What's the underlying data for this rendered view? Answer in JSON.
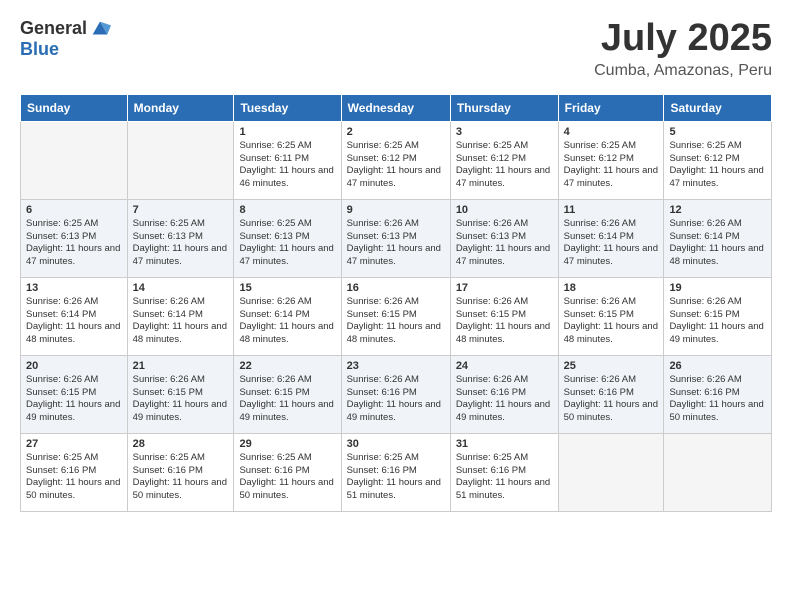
{
  "header": {
    "logo_general": "General",
    "logo_blue": "Blue",
    "month": "July 2025",
    "location": "Cumba, Amazonas, Peru"
  },
  "days_of_week": [
    "Sunday",
    "Monday",
    "Tuesday",
    "Wednesday",
    "Thursday",
    "Friday",
    "Saturday"
  ],
  "weeks": [
    [
      {
        "day": "",
        "sunrise": "",
        "sunset": "",
        "daylight": "",
        "empty": true
      },
      {
        "day": "",
        "sunrise": "",
        "sunset": "",
        "daylight": "",
        "empty": true
      },
      {
        "day": "1",
        "sunrise": "Sunrise: 6:25 AM",
        "sunset": "Sunset: 6:11 PM",
        "daylight": "Daylight: 11 hours and 46 minutes."
      },
      {
        "day": "2",
        "sunrise": "Sunrise: 6:25 AM",
        "sunset": "Sunset: 6:12 PM",
        "daylight": "Daylight: 11 hours and 47 minutes."
      },
      {
        "day": "3",
        "sunrise": "Sunrise: 6:25 AM",
        "sunset": "Sunset: 6:12 PM",
        "daylight": "Daylight: 11 hours and 47 minutes."
      },
      {
        "day": "4",
        "sunrise": "Sunrise: 6:25 AM",
        "sunset": "Sunset: 6:12 PM",
        "daylight": "Daylight: 11 hours and 47 minutes."
      },
      {
        "day": "5",
        "sunrise": "Sunrise: 6:25 AM",
        "sunset": "Sunset: 6:12 PM",
        "daylight": "Daylight: 11 hours and 47 minutes."
      }
    ],
    [
      {
        "day": "6",
        "sunrise": "Sunrise: 6:25 AM",
        "sunset": "Sunset: 6:13 PM",
        "daylight": "Daylight: 11 hours and 47 minutes."
      },
      {
        "day": "7",
        "sunrise": "Sunrise: 6:25 AM",
        "sunset": "Sunset: 6:13 PM",
        "daylight": "Daylight: 11 hours and 47 minutes."
      },
      {
        "day": "8",
        "sunrise": "Sunrise: 6:25 AM",
        "sunset": "Sunset: 6:13 PM",
        "daylight": "Daylight: 11 hours and 47 minutes."
      },
      {
        "day": "9",
        "sunrise": "Sunrise: 6:26 AM",
        "sunset": "Sunset: 6:13 PM",
        "daylight": "Daylight: 11 hours and 47 minutes."
      },
      {
        "day": "10",
        "sunrise": "Sunrise: 6:26 AM",
        "sunset": "Sunset: 6:13 PM",
        "daylight": "Daylight: 11 hours and 47 minutes."
      },
      {
        "day": "11",
        "sunrise": "Sunrise: 6:26 AM",
        "sunset": "Sunset: 6:14 PM",
        "daylight": "Daylight: 11 hours and 47 minutes."
      },
      {
        "day": "12",
        "sunrise": "Sunrise: 6:26 AM",
        "sunset": "Sunset: 6:14 PM",
        "daylight": "Daylight: 11 hours and 48 minutes."
      }
    ],
    [
      {
        "day": "13",
        "sunrise": "Sunrise: 6:26 AM",
        "sunset": "Sunset: 6:14 PM",
        "daylight": "Daylight: 11 hours and 48 minutes."
      },
      {
        "day": "14",
        "sunrise": "Sunrise: 6:26 AM",
        "sunset": "Sunset: 6:14 PM",
        "daylight": "Daylight: 11 hours and 48 minutes."
      },
      {
        "day": "15",
        "sunrise": "Sunrise: 6:26 AM",
        "sunset": "Sunset: 6:14 PM",
        "daylight": "Daylight: 11 hours and 48 minutes."
      },
      {
        "day": "16",
        "sunrise": "Sunrise: 6:26 AM",
        "sunset": "Sunset: 6:15 PM",
        "daylight": "Daylight: 11 hours and 48 minutes."
      },
      {
        "day": "17",
        "sunrise": "Sunrise: 6:26 AM",
        "sunset": "Sunset: 6:15 PM",
        "daylight": "Daylight: 11 hours and 48 minutes."
      },
      {
        "day": "18",
        "sunrise": "Sunrise: 6:26 AM",
        "sunset": "Sunset: 6:15 PM",
        "daylight": "Daylight: 11 hours and 48 minutes."
      },
      {
        "day": "19",
        "sunrise": "Sunrise: 6:26 AM",
        "sunset": "Sunset: 6:15 PM",
        "daylight": "Daylight: 11 hours and 49 minutes."
      }
    ],
    [
      {
        "day": "20",
        "sunrise": "Sunrise: 6:26 AM",
        "sunset": "Sunset: 6:15 PM",
        "daylight": "Daylight: 11 hours and 49 minutes."
      },
      {
        "day": "21",
        "sunrise": "Sunrise: 6:26 AM",
        "sunset": "Sunset: 6:15 PM",
        "daylight": "Daylight: 11 hours and 49 minutes."
      },
      {
        "day": "22",
        "sunrise": "Sunrise: 6:26 AM",
        "sunset": "Sunset: 6:15 PM",
        "daylight": "Daylight: 11 hours and 49 minutes."
      },
      {
        "day": "23",
        "sunrise": "Sunrise: 6:26 AM",
        "sunset": "Sunset: 6:16 PM",
        "daylight": "Daylight: 11 hours and 49 minutes."
      },
      {
        "day": "24",
        "sunrise": "Sunrise: 6:26 AM",
        "sunset": "Sunset: 6:16 PM",
        "daylight": "Daylight: 11 hours and 49 minutes."
      },
      {
        "day": "25",
        "sunrise": "Sunrise: 6:26 AM",
        "sunset": "Sunset: 6:16 PM",
        "daylight": "Daylight: 11 hours and 50 minutes."
      },
      {
        "day": "26",
        "sunrise": "Sunrise: 6:26 AM",
        "sunset": "Sunset: 6:16 PM",
        "daylight": "Daylight: 11 hours and 50 minutes."
      }
    ],
    [
      {
        "day": "27",
        "sunrise": "Sunrise: 6:25 AM",
        "sunset": "Sunset: 6:16 PM",
        "daylight": "Daylight: 11 hours and 50 minutes."
      },
      {
        "day": "28",
        "sunrise": "Sunrise: 6:25 AM",
        "sunset": "Sunset: 6:16 PM",
        "daylight": "Daylight: 11 hours and 50 minutes."
      },
      {
        "day": "29",
        "sunrise": "Sunrise: 6:25 AM",
        "sunset": "Sunset: 6:16 PM",
        "daylight": "Daylight: 11 hours and 50 minutes."
      },
      {
        "day": "30",
        "sunrise": "Sunrise: 6:25 AM",
        "sunset": "Sunset: 6:16 PM",
        "daylight": "Daylight: 11 hours and 51 minutes."
      },
      {
        "day": "31",
        "sunrise": "Sunrise: 6:25 AM",
        "sunset": "Sunset: 6:16 PM",
        "daylight": "Daylight: 11 hours and 51 minutes."
      },
      {
        "day": "",
        "sunrise": "",
        "sunset": "",
        "daylight": "",
        "empty": true
      },
      {
        "day": "",
        "sunrise": "",
        "sunset": "",
        "daylight": "",
        "empty": true
      }
    ]
  ]
}
